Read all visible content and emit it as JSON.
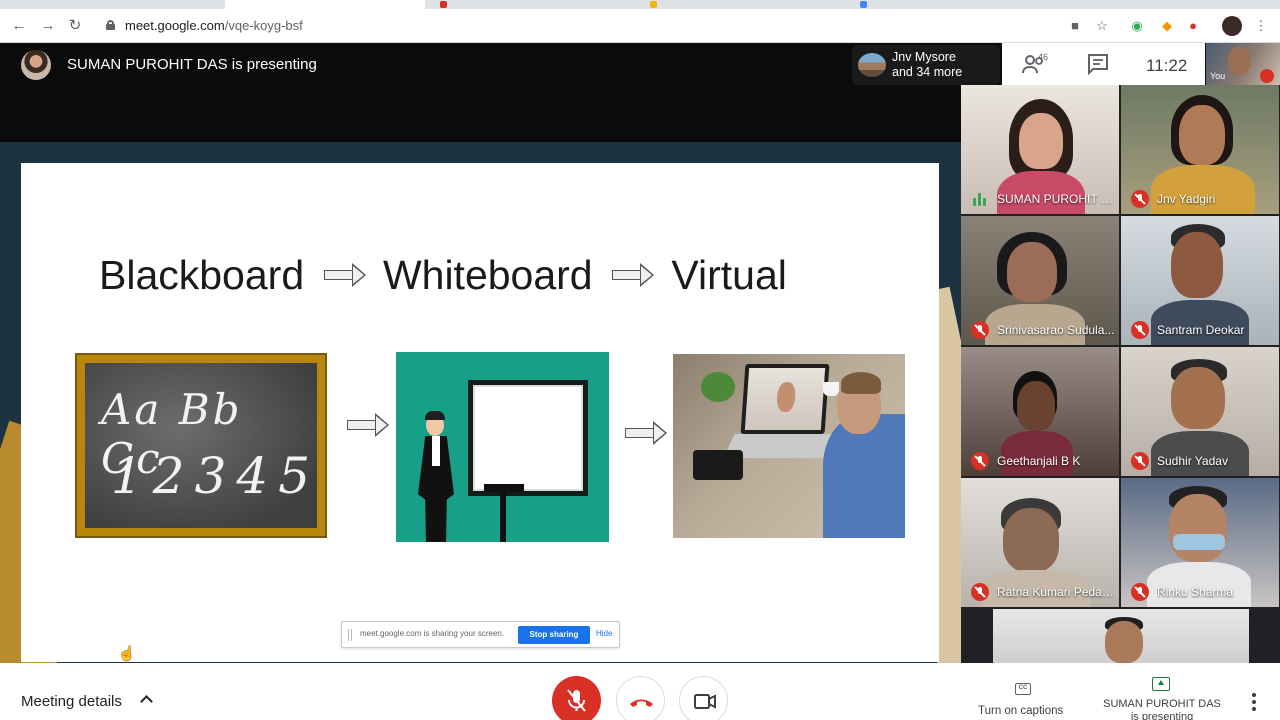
{
  "browser": {
    "url_host": "meet.google.com",
    "url_path": "/vqe-koyg-bsf"
  },
  "topbar": {
    "presenting_title": "SUMAN PUROHIT DAS is presenting",
    "participants_line1": "Jnv Mysore",
    "participants_line2": "and 34 more",
    "people_count": "46",
    "clock": "11:22",
    "self_label": "You"
  },
  "slide": {
    "word1": "Blackboard",
    "word2": "Whiteboard",
    "word3": "Virtual",
    "chalk_line1": "Aa Bb Cc",
    "chalk_line2": "12345"
  },
  "share_bar": {
    "message": "meet.google.com is sharing your screen.",
    "stop_label": "Stop sharing",
    "hide_label": "Hide"
  },
  "participants": [
    {
      "name": "SUMAN PUROHIT D...",
      "muted": false,
      "speaking": true
    },
    {
      "name": "Jnv Yadgiri",
      "muted": true
    },
    {
      "name": "Srinivasarao Sudula...",
      "muted": true
    },
    {
      "name": "Santram Deokar",
      "muted": true
    },
    {
      "name": "Geethanjali B K",
      "muted": true
    },
    {
      "name": "Sudhir Yadav",
      "muted": true
    },
    {
      "name": "Ratna Kumari Pedap...",
      "muted": true
    },
    {
      "name": "Rinku Sharma",
      "muted": true
    }
  ],
  "bottombar": {
    "meeting_details": "Meeting details",
    "captions_label": "Turn on captions",
    "presenting_line1": "SUMAN PUROHIT DAS",
    "presenting_line2": "is presenting"
  },
  "colors": {
    "accent_blue": "#1a73e8",
    "danger_red": "#d93025",
    "present_green": "#188038"
  }
}
